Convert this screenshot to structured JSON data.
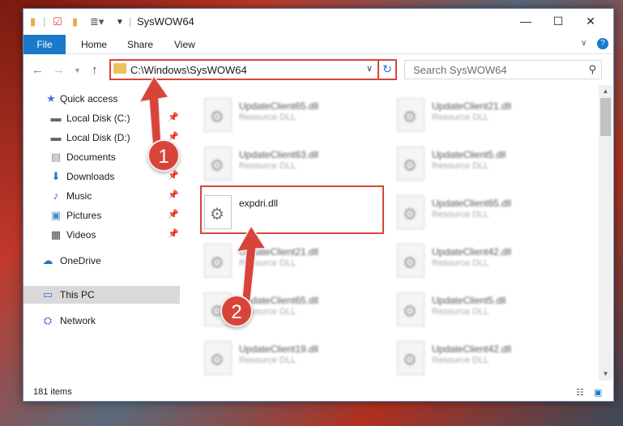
{
  "window": {
    "title": "SysWOW64",
    "controls": [
      "—",
      "☐",
      "✕"
    ]
  },
  "ribbon": {
    "tabs": [
      "File",
      "Home",
      "Share",
      "View"
    ]
  },
  "address": {
    "path": "C:\\Windows\\SysWOW64",
    "search_placeholder": "Search SysWOW64"
  },
  "sidebar": {
    "items": [
      {
        "label": "Quick access",
        "icon": "star-icon"
      },
      {
        "label": "Local Disk (C:)",
        "icon": "drive-icon",
        "pinned": true
      },
      {
        "label": "Local Disk (D:)",
        "icon": "drive-icon",
        "pinned": true
      },
      {
        "label": "Documents",
        "icon": "documents-icon",
        "pinned": true
      },
      {
        "label": "Downloads",
        "icon": "download-icon",
        "pinned": true
      },
      {
        "label": "Music",
        "icon": "music-icon",
        "pinned": true
      },
      {
        "label": "Pictures",
        "icon": "pictures-icon",
        "pinned": true
      },
      {
        "label": "Videos",
        "icon": "videos-icon",
        "pinned": true
      },
      {
        "label": "OneDrive",
        "icon": "cloud-icon"
      },
      {
        "label": "This PC",
        "icon": "computer-icon",
        "selected": true
      },
      {
        "label": "Network",
        "icon": "network-icon"
      }
    ]
  },
  "files": {
    "left": [
      {
        "name": "UpdateClient65.dll",
        "type": "Resource DLL"
      },
      {
        "name": "UpdateClient63.dll",
        "type": "Resource DLL"
      },
      {
        "name": "expdri.dll",
        "type": ""
      },
      {
        "name": "UpdateClient21.dll",
        "type": "Resource DLL"
      },
      {
        "name": "UpdateClient65.dll",
        "type": "Resource DLL"
      },
      {
        "name": "UpdateClient19.dll",
        "type": "Resource DLL"
      }
    ],
    "right": [
      {
        "name": "UpdateClient21.dll",
        "type": "Resource DLL"
      },
      {
        "name": "UpdateClient5.dll",
        "type": "Resource DLL"
      },
      {
        "name": "UpdateClient65.dll",
        "type": "Resource DLL"
      },
      {
        "name": "UpdateClient42.dll",
        "type": "Resource DLL"
      },
      {
        "name": "UpdateClient5.dll",
        "type": "Resource DLL"
      },
      {
        "name": "UpdateClient42.dll",
        "type": "Resource DLL"
      }
    ]
  },
  "status": {
    "item_count": "181 items"
  },
  "callouts": {
    "step1": "1",
    "step2": "2"
  },
  "colors": {
    "accent": "#1979ca",
    "callout": "#d9443a",
    "selected_bg": "#d9d9d9"
  }
}
